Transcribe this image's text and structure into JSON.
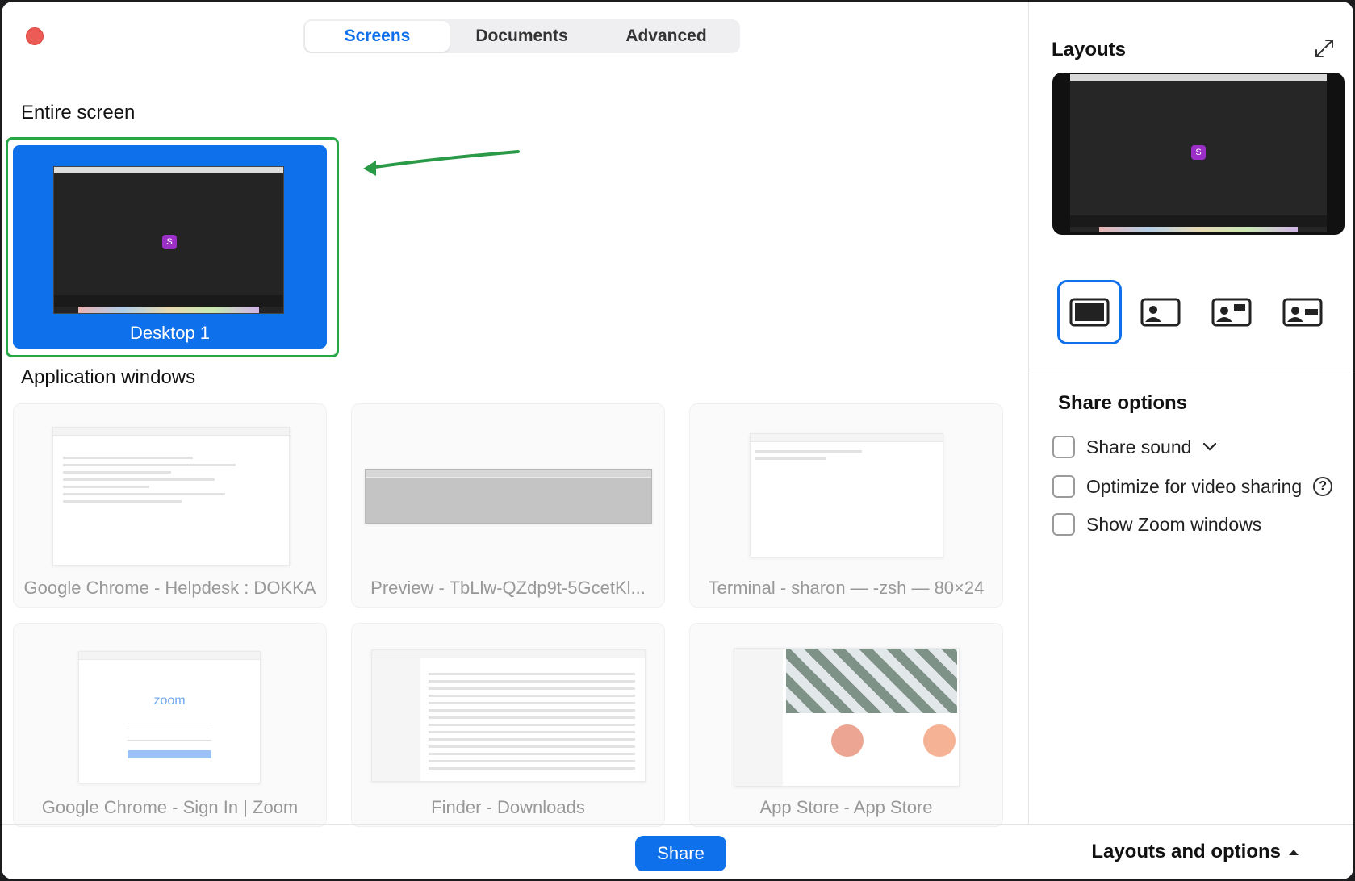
{
  "tabs": [
    {
      "label": "Screens",
      "active": true
    },
    {
      "label": "Documents",
      "active": false
    },
    {
      "label": "Advanced",
      "active": false
    }
  ],
  "entire_screen": {
    "title": "Entire screen",
    "desktop_label": "Desktop 1",
    "avatar_initial": "S"
  },
  "app_windows": {
    "title": "Application windows",
    "items": [
      {
        "label": "Google Chrome - Helpdesk : DOKKA"
      },
      {
        "label": "Preview - TbLlw-QZdp9t-5GcetKl..."
      },
      {
        "label": "Terminal - sharon — -zsh — 80×24"
      },
      {
        "label": "Google Chrome - Sign In | Zoom"
      },
      {
        "label": "Finder - Downloads"
      },
      {
        "label": "App Store - App Store"
      }
    ],
    "zoom_logo_text": "zoom"
  },
  "footer": {
    "share_label": "Share",
    "layouts_and_options_label": "Layouts and options"
  },
  "right_panel": {
    "layouts_title": "Layouts",
    "preview_avatar": "S",
    "layout_options": [
      {
        "icon": "screen-only-layout-icon",
        "active": true
      },
      {
        "icon": "speaker-left-layout-icon",
        "active": false
      },
      {
        "icon": "speaker-topleft-layout-icon",
        "active": false
      },
      {
        "icon": "speaker-right-layout-icon",
        "active": false
      }
    ],
    "share_options_title": "Share options",
    "options": [
      {
        "label": "Share sound",
        "checked": false
      },
      {
        "label": "Optimize for video sharing",
        "checked": false
      },
      {
        "label": "Show Zoom windows",
        "checked": false
      }
    ]
  },
  "colors": {
    "accent": "#0e71eb",
    "highlight": "#27a745",
    "avatar": "#9b2fc7",
    "close": "#ec5b55"
  }
}
